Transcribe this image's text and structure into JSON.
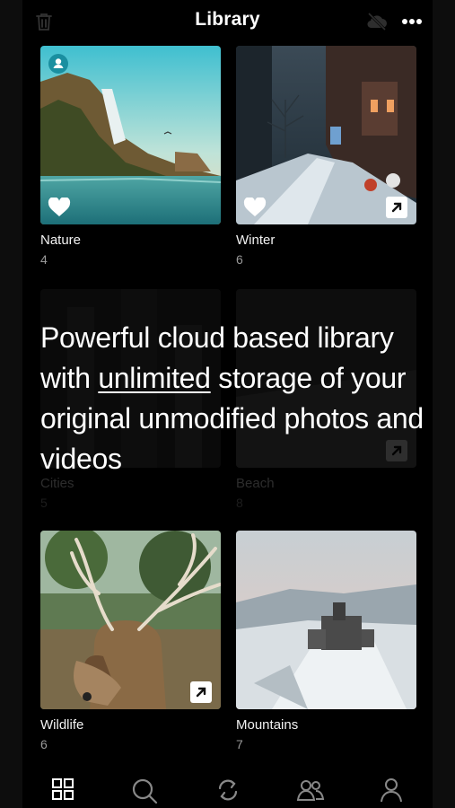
{
  "header": {
    "title": "Library",
    "left_icon": "trash-icon",
    "right_icons": [
      "cloud-off-icon",
      "more-icon"
    ]
  },
  "albums": [
    {
      "name": "Nature",
      "count": "4",
      "favorite": true,
      "shared_user": true
    },
    {
      "name": "Winter",
      "count": "6",
      "favorite": true,
      "link": true
    },
    {
      "name": "Cities",
      "count": "5"
    },
    {
      "name": "Beach",
      "count": "8",
      "link": true
    },
    {
      "name": "Wildlife",
      "count": "6",
      "link": true
    },
    {
      "name": "Mountains",
      "count": "7"
    }
  ],
  "promo": {
    "line1_before": "Powerful cloud based library with ",
    "emphasis": "unlimited",
    "line_after": " storage of your original unmodified photos and videos"
  },
  "tabbar": {
    "items": [
      "grid-icon",
      "search-icon",
      "sync-icon",
      "people-icon",
      "profile-icon"
    ],
    "active": "grid-icon"
  },
  "colors": {
    "background": "#000000",
    "text": "#ffffff",
    "secondary_text": "#9a9a9a"
  }
}
